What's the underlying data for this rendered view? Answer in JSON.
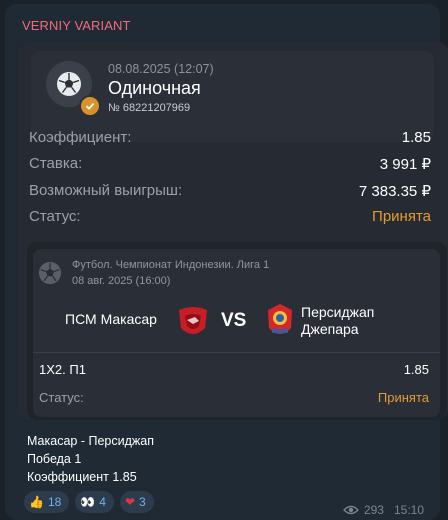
{
  "channel": {
    "name": "VERNIY VARIANT"
  },
  "bet": {
    "datetime": "08.08.2025 (12:07)",
    "type": "Одиночная",
    "number": "№ 68221207969",
    "rows": [
      {
        "label": "Коэффициент:",
        "value": "1.85"
      },
      {
        "label": "Ставка:",
        "value": "3 991 ₽"
      },
      {
        "label": "Возможный выигрыш:",
        "value": "7 383.35 ₽"
      },
      {
        "label": "Статус:",
        "value": "Принята"
      }
    ],
    "status_color": "#e39a34"
  },
  "event": {
    "league": "Футбол. Чемпионат Индонезии. Лига 1",
    "date": "08 авг. 2025 (16:00)",
    "team1": "ПСМ Макасар",
    "vs": "VS",
    "team2_line1": "Персиджап",
    "team2_line2": "Джепара",
    "pick": "1Х2. П1",
    "pick_odds": "1.85",
    "status_label": "Статус:",
    "status": "Принята"
  },
  "caption": {
    "line1": "Макасар - Персиджап",
    "line2": "Победа 1",
    "line3": "Коэффициент 1.85"
  },
  "reactions": [
    {
      "icon": "thumbs-up-icon",
      "emoji": "👍",
      "count": "18"
    },
    {
      "icon": "eyes-icon",
      "emoji": "👀",
      "count": "4"
    },
    {
      "icon": "heart-icon",
      "emoji": "❤",
      "count": "3"
    }
  ],
  "meta": {
    "views": "293",
    "time": "15:10"
  }
}
